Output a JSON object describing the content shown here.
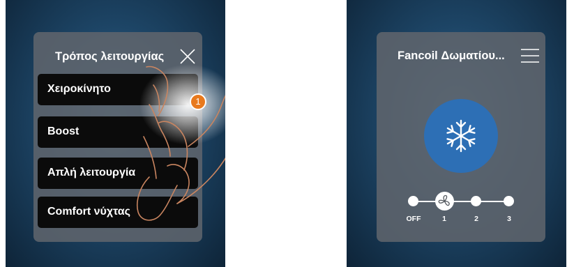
{
  "left_screen": {
    "title": "Τρόπος λειτουργίας",
    "modes": [
      {
        "label": "Χειροκίνητο"
      },
      {
        "label": "Boost"
      },
      {
        "label": "Απλή λειτουργία"
      },
      {
        "label": "Comfort νύχτας"
      }
    ],
    "step_number": "1"
  },
  "right_screen": {
    "title": "Fancoil Δωματίου...",
    "current_mode_icon": "snowflake-icon",
    "speed_labels": [
      "OFF",
      "1",
      "2",
      "3"
    ],
    "selected_speed": "1",
    "selected_speed_icon": "fan-icon"
  },
  "colors": {
    "accent_blue": "#2d6fb5",
    "badge_orange": "#e8791d",
    "panel_gray": "#5f646c",
    "item_black": "#0b0b0b"
  }
}
